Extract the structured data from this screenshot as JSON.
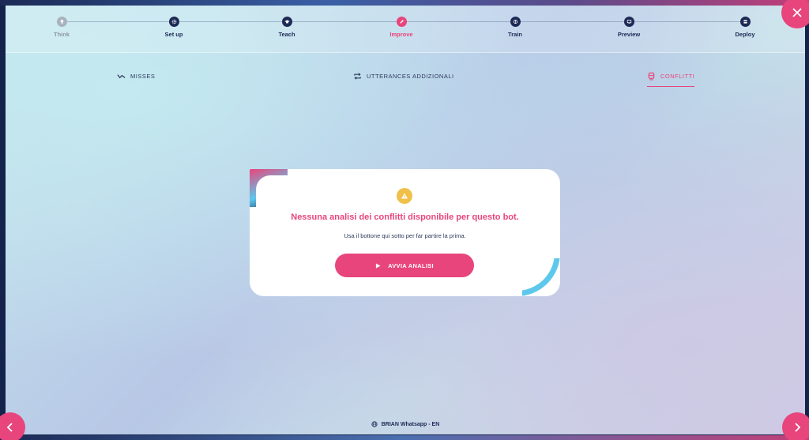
{
  "stepper": {
    "steps": [
      {
        "label": "Think",
        "icon": "lightbulb-icon",
        "state": "done"
      },
      {
        "label": "Set up",
        "icon": "gear-icon",
        "state": "pending"
      },
      {
        "label": "Teach",
        "icon": "graduation-cap-icon",
        "state": "pending"
      },
      {
        "label": "Improve",
        "icon": "pencil-icon",
        "state": "active"
      },
      {
        "label": "Train",
        "icon": "brain-icon",
        "state": "pending"
      },
      {
        "label": "Preview",
        "icon": "screen-icon",
        "state": "pending"
      },
      {
        "label": "Deploy",
        "icon": "server-icon",
        "state": "pending"
      }
    ]
  },
  "tabs": [
    {
      "label": "MISSES",
      "icon": "trend-icon",
      "active": false
    },
    {
      "label": "UTTERANCES ADDIZIONALI",
      "icon": "repeat-icon",
      "active": false
    },
    {
      "label": "CONFLITTI",
      "icon": "train-icon",
      "active": true
    }
  ],
  "card": {
    "icon": "warning-icon",
    "title": "Nessuna analisi dei conflitti disponibile per questo bot.",
    "subtitle": "Usa il bottone qui sotto per far partire la prima.",
    "button_label": "AVVIA ANALISI",
    "button_icon": "play-icon"
  },
  "footer": {
    "icon": "globe-icon",
    "bot_name": "BRIAN Whatsapp - EN"
  },
  "nav": {
    "close_icon": "close-icon",
    "prev_icon": "chevron-left-icon",
    "next_icon": "chevron-right-icon"
  },
  "colors": {
    "accent": "#e8457c",
    "navy": "#1d2a55",
    "cyan": "#5ec8ec",
    "warning": "#f0c04a"
  }
}
